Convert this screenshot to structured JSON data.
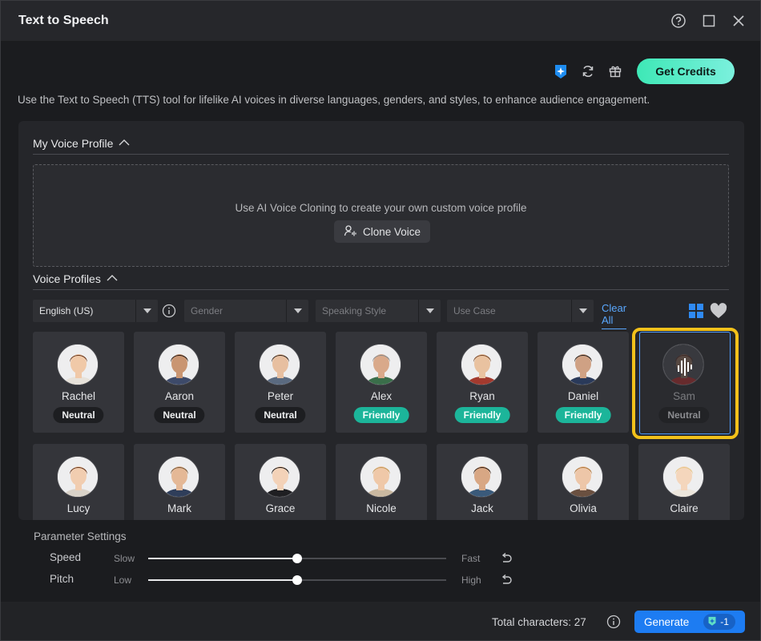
{
  "window": {
    "title": "Text to Speech"
  },
  "top_actions": {
    "get_credits_label": "Get Credits"
  },
  "description": "Use the Text to Speech (TTS) tool for lifelike AI voices in diverse languages, genders, and styles, to enhance audience engagement.",
  "my_voice_profile": {
    "heading": "My Voice Profile",
    "prompt": "Use AI Voice Cloning to create your own custom voice profile",
    "clone_button": "Clone Voice"
  },
  "voice_profiles": {
    "heading": "Voice Profiles",
    "filters": {
      "language": "English (US)",
      "gender_placeholder": "Gender",
      "style_placeholder": "Speaking Style",
      "usecase_placeholder": "Use Case",
      "clear_all": "Clear All"
    },
    "voices": [
      {
        "name": "Rachel",
        "tag": "Neutral",
        "tag_type": "neutral"
      },
      {
        "name": "Aaron",
        "tag": "Neutral",
        "tag_type": "neutral"
      },
      {
        "name": "Peter",
        "tag": "Neutral",
        "tag_type": "neutral"
      },
      {
        "name": "Alex",
        "tag": "Friendly",
        "tag_type": "friendly"
      },
      {
        "name": "Ryan",
        "tag": "Friendly",
        "tag_type": "friendly"
      },
      {
        "name": "Daniel",
        "tag": "Friendly",
        "tag_type": "friendly"
      },
      {
        "name": "Sam",
        "tag": "Neutral",
        "tag_type": "neutral",
        "selected": true
      },
      {
        "name": "Lucy"
      },
      {
        "name": "Mark"
      },
      {
        "name": "Grace"
      },
      {
        "name": "Nicole"
      },
      {
        "name": "Jack"
      },
      {
        "name": "Olivia"
      },
      {
        "name": "Claire"
      }
    ]
  },
  "parameters": {
    "title": "Parameter Settings",
    "speed": {
      "label": "Speed",
      "low": "Slow",
      "high": "Fast",
      "value": 0.5
    },
    "pitch": {
      "label": "Pitch",
      "low": "Low",
      "high": "High",
      "value": 0.5
    }
  },
  "footer": {
    "total_characters": "Total characters: 27",
    "generate_label": "Generate",
    "credit_cost": "-1"
  },
  "colors": {
    "accent_blue": "#1d7cf2",
    "friendly_green": "#1cb59a",
    "highlight_yellow": "#f2c11a",
    "credits_gradient_start": "#3ee8b6"
  }
}
